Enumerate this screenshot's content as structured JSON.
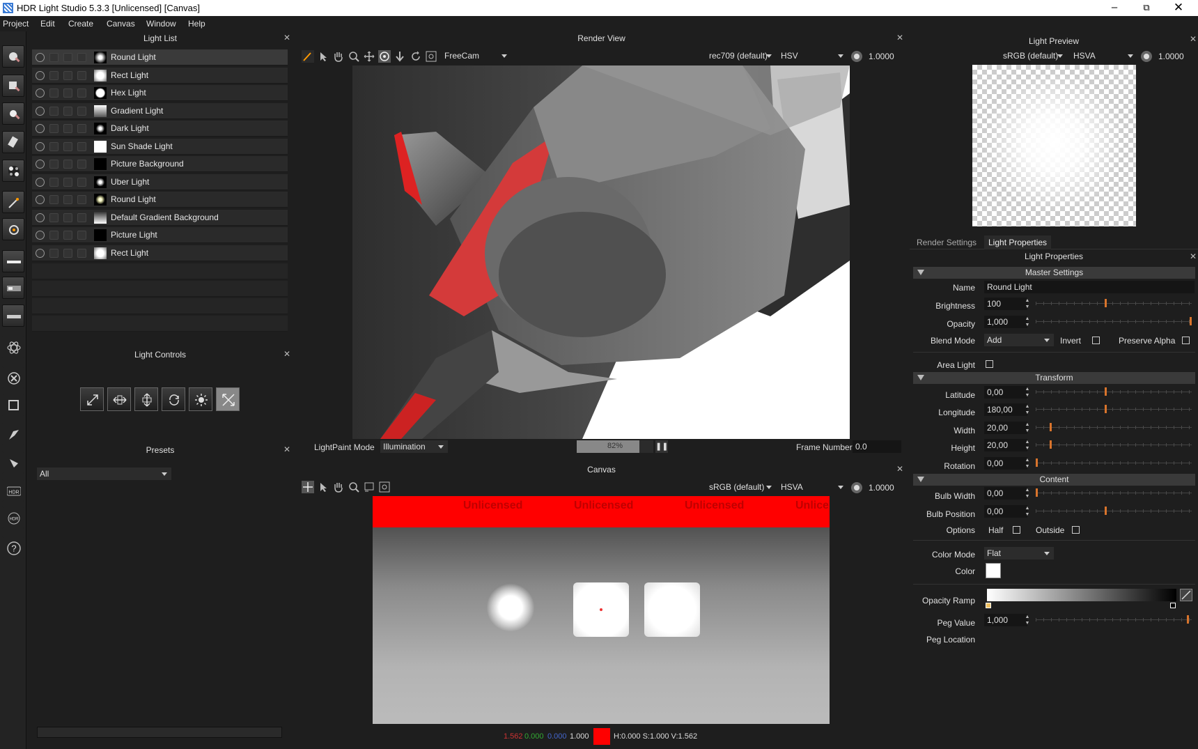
{
  "titlebar": {
    "title": "HDR Light Studio 5.3.3 [Unlicensed] [Canvas]"
  },
  "menu": [
    "Project",
    "Edit",
    "Create",
    "Canvas",
    "Window",
    "Help"
  ],
  "light_list": {
    "title": "Light List",
    "items": [
      {
        "label": "Round Light",
        "thumb": "radial"
      },
      {
        "label": "Rect Light",
        "thumb": "rect"
      },
      {
        "label": "Hex Light",
        "thumb": "hex"
      },
      {
        "label": "Gradient Light",
        "thumb": "gradient"
      },
      {
        "label": "Dark Light",
        "thumb": "radial-small"
      },
      {
        "label": "Sun Shade Light",
        "thumb": "white"
      },
      {
        "label": "Picture Background",
        "thumb": "black"
      },
      {
        "label": "Uber Light",
        "thumb": "radial-small"
      },
      {
        "label": "Round Light",
        "thumb": "radial-yellow"
      },
      {
        "label": "Default Gradient Background",
        "thumb": "gradient"
      },
      {
        "label": "Picture Light",
        "thumb": "black"
      },
      {
        "label": "Rect Light",
        "thumb": "rect"
      }
    ]
  },
  "light_controls": {
    "title": "Light Controls"
  },
  "presets": {
    "title": "Presets",
    "filter": "All"
  },
  "render_view": {
    "title": "Render View",
    "camera": "FreeCam",
    "colorspace": "rec709 (default)",
    "color_mode": "HSV",
    "exposure": "1.0000",
    "lightpaint_label": "LightPaint Mode",
    "lightpaint_mode": "Illumination",
    "progress_text": "82%",
    "progress": 0.82,
    "frame_label": "Frame Number",
    "frame_value": "0.0"
  },
  "canvas": {
    "title": "Canvas",
    "colorspace": "sRGB (default)",
    "color_mode": "HSVA",
    "exposure": "1.0000",
    "watermark": [
      "Unlicensed",
      "Unlicensed",
      "Unlicensed",
      "Unlice"
    ],
    "readout": {
      "r": "1.562",
      "g": "0.000",
      "b": "0.000",
      "a": "1.000",
      "hsv": "H:0.000 S:1.000 V:1.562"
    }
  },
  "light_preview": {
    "title": "Light Preview",
    "colorspace": "sRGB (default)",
    "color_mode": "HSVA",
    "exposure": "1.0000"
  },
  "props": {
    "tabs": [
      "Render Settings",
      "Light Properties"
    ],
    "title": "Light Properties",
    "sections": {
      "master": "Master Settings",
      "transform": "Transform",
      "content": "Content"
    },
    "labels": {
      "name": "Name",
      "brightness": "Brightness",
      "opacity": "Opacity",
      "blend_mode": "Blend Mode",
      "invert": "Invert",
      "preserve_alpha": "Preserve Alpha",
      "area_light": "Area Light",
      "latitude": "Latitude",
      "longitude": "Longitude",
      "width": "Width",
      "height": "Height",
      "rotation": "Rotation",
      "bulb_width": "Bulb Width",
      "bulb_position": "Bulb Position",
      "options": "Options",
      "half": "Half",
      "outside": "Outside",
      "color_mode": "Color Mode",
      "color": "Color",
      "opacity_ramp": "Opacity Ramp",
      "peg_value": "Peg Value",
      "peg_location": "Peg Location"
    },
    "values": {
      "name": "Round Light",
      "brightness": "100",
      "opacity": "1,000",
      "blend_mode": "Add",
      "latitude": "0,00",
      "longitude": "180,00",
      "width": "20,00",
      "height": "20,00",
      "rotation": "0,00",
      "bulb_width": "0,00",
      "bulb_position": "0,00",
      "color_mode": "Flat",
      "peg_value": "1,000"
    },
    "slider_levels": {
      "brightness": 0.45,
      "opacity": 1.0,
      "latitude": 0.45,
      "longitude": 0.45,
      "width": 0.09,
      "height": 0.09,
      "rotation": 0.0,
      "bulb_width": 0.0,
      "bulb_position": 0.45,
      "peg_value": 0.98
    },
    "color_value": "#ffffff"
  },
  "toolbar_icons": [
    "round-light-icon",
    "rect-light-icon",
    "spot-light-icon",
    "pen-light-icon",
    "hdr-map-icon",
    "magic-wand-icon",
    "light-settings-icon",
    "strip-light-icon",
    "picture-strip-icon",
    "dark-strip-icon",
    "atom-icon",
    "close-circle-icon",
    "crop-icon",
    "paint-brush-icon",
    "paint-tool-icon",
    "hdr-icon",
    "hdr-refresh-icon",
    "help-icon"
  ],
  "colors": {
    "accent_orange": "#d9742c",
    "watermark_red": "#ff0000"
  }
}
